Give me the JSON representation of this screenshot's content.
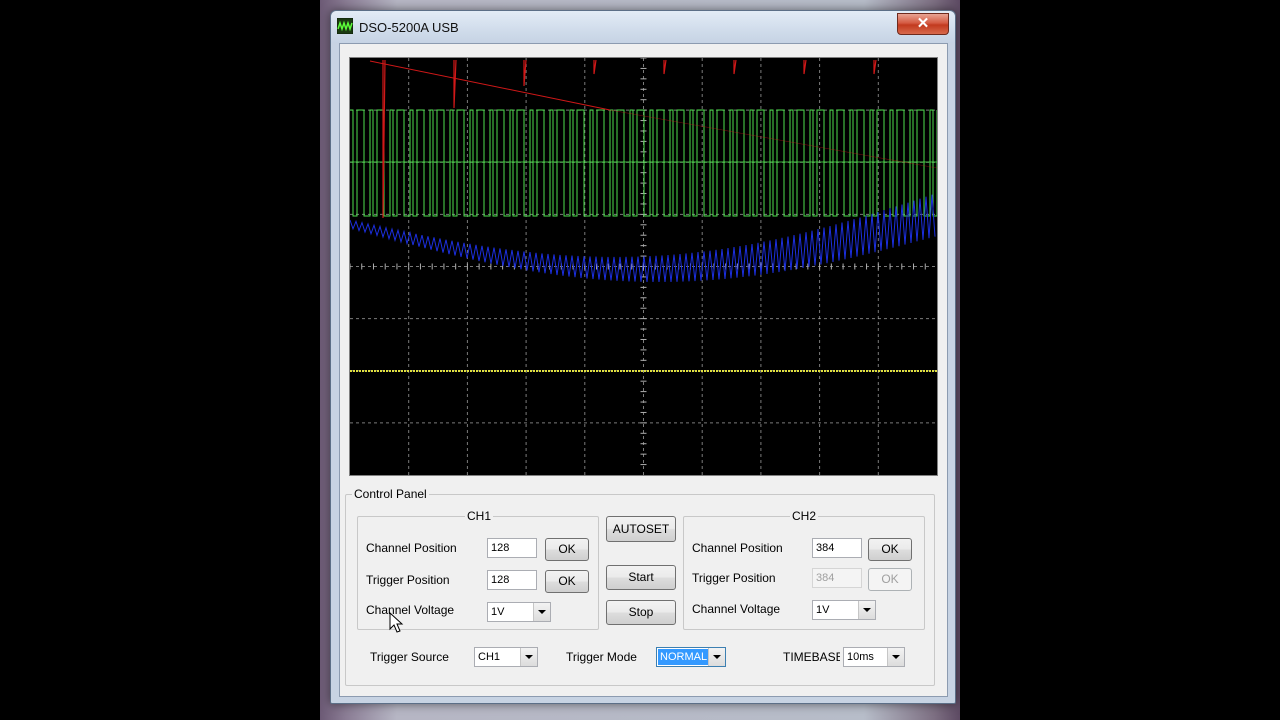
{
  "window": {
    "title": "DSO-5200A USB",
    "close": "✕"
  },
  "control_panel": {
    "title": "Control Panel",
    "ch1": {
      "title": "CH1",
      "channel_position_label": "Channel Position",
      "channel_position": "128",
      "trigger_position_label": "Trigger Position",
      "trigger_position": "128",
      "channel_voltage_label": "Channel  Voltage",
      "channel_voltage": "1V",
      "ok": "OK"
    },
    "ch2": {
      "title": "CH2",
      "channel_position_label": "Channel Position",
      "channel_position": "384",
      "trigger_position_label": "Trigger Position",
      "trigger_position": "384",
      "channel_voltage_label": "Channel  Voltage",
      "channel_voltage": "1V",
      "ok": "OK"
    },
    "autoset": "AUTOSET",
    "start": "Start",
    "stop": "Stop",
    "trigger_source_label": "Trigger Source",
    "trigger_source": "CH1",
    "trigger_mode_label": "Trigger Mode",
    "trigger_mode": "NORMAL",
    "timebase_label": "TIMEBASE",
    "timebase": "10ms"
  },
  "colors": {
    "trace_green": "#4ee04e",
    "trace_blue": "#1c2fe0",
    "trace_red": "#d01818",
    "trace_yellow": "#e0e040",
    "grid": "#b0b0b0"
  }
}
